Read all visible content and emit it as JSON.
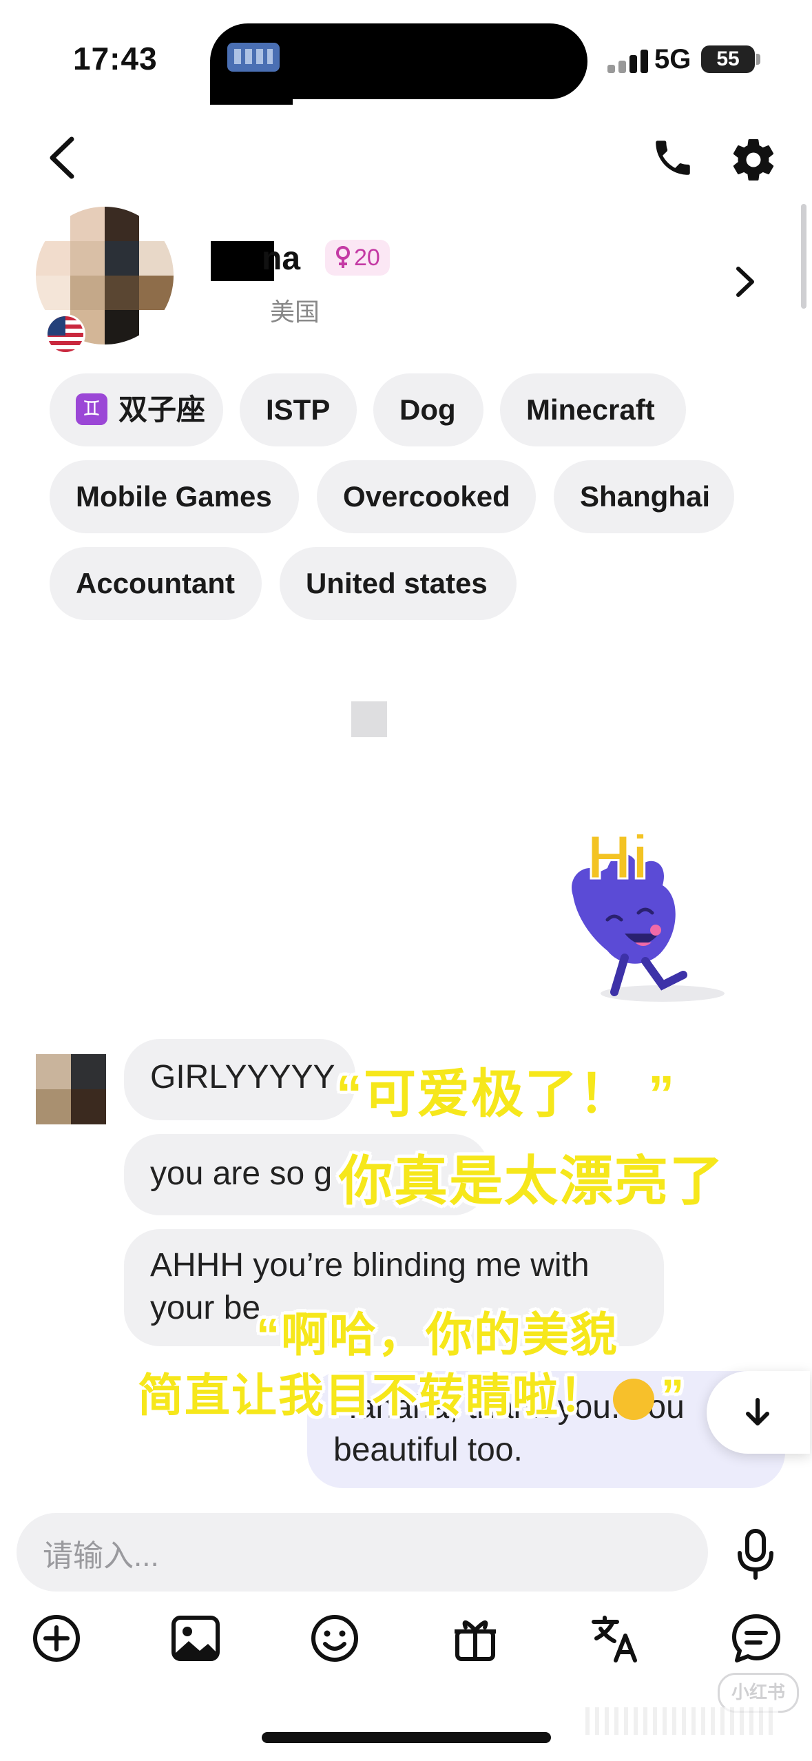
{
  "status_bar": {
    "time": "17:43",
    "network": "5G",
    "battery": "55"
  },
  "profile": {
    "name_visible": "na",
    "gender_age": "20",
    "location": "美国"
  },
  "tags": [
    {
      "label": "双子座"
    },
    {
      "label": "ISTP"
    },
    {
      "label": "Dog"
    },
    {
      "label": "Minecraft"
    },
    {
      "label": "Mobile Games"
    },
    {
      "label": "Overcooked"
    },
    {
      "label": "Shanghai"
    },
    {
      "label": "Accountant"
    },
    {
      "label": "United states"
    }
  ],
  "sticker": {
    "text": "Hi"
  },
  "messages": [
    {
      "from": "them",
      "text": "GIRLYYYYY"
    },
    {
      "from": "them",
      "text": "you are so g"
    },
    {
      "from": "them",
      "line1": "AHHH you’re  blinding  me with",
      "line2": "your be"
    },
    {
      "from": "me",
      "line1": "Hahaha, thank you. You",
      "line2": "beautiful too."
    }
  ],
  "overlays": {
    "caption1": "“可爱极了！ ”",
    "caption2": "你真是太漂亮了",
    "caption3": "“啊哈，你的美貌",
    "caption4": "简直让我目不转睛啦！",
    "caption4_end": "”"
  },
  "composer": {
    "placeholder": "请输入..."
  },
  "toolbar": {
    "icons": [
      "add-icon",
      "image-icon",
      "emoji-icon",
      "gift-icon",
      "translate-icon",
      "chat-icon"
    ]
  },
  "watermark": "小红书",
  "colors": {
    "accent_pink": "#c43aa4",
    "caption_yellow": "#f6e71b",
    "sticker_purple": "#5b4bd6"
  }
}
